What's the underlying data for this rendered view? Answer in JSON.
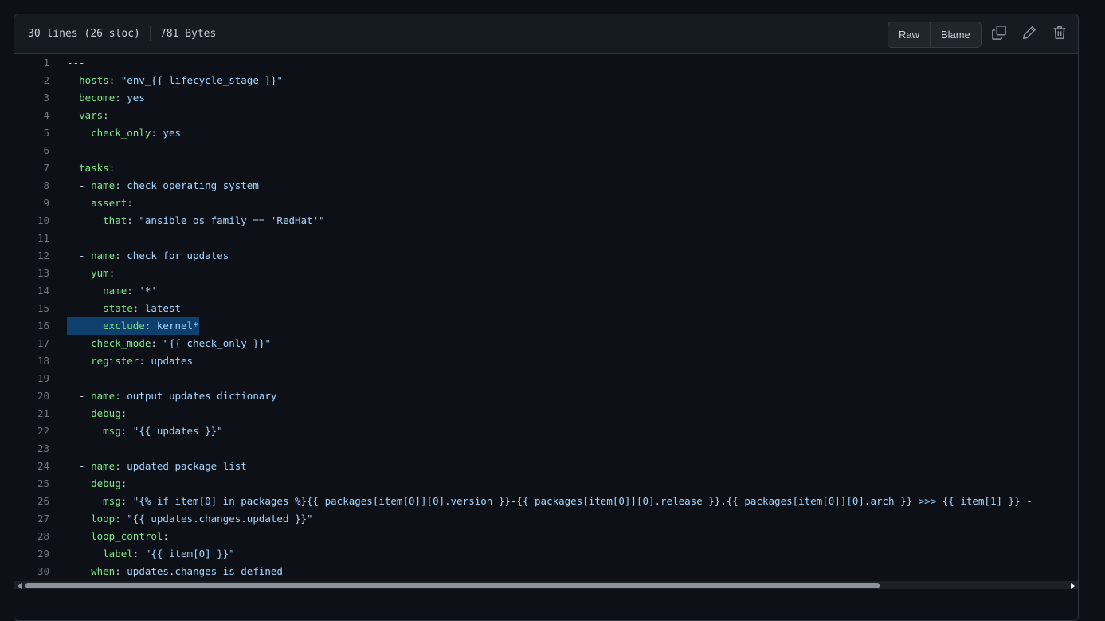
{
  "file_info": {
    "lines": "30 lines (26 sloc)",
    "size": "781 Bytes"
  },
  "toolbar": {
    "raw_label": "Raw",
    "blame_label": "Blame",
    "copy_icon": "copy-icon",
    "edit_icon": "pencil-icon",
    "delete_icon": "trash-icon"
  },
  "colors": {
    "background": "#0d1117",
    "header": "#161b22",
    "key": "#7ee787",
    "string": "#a5d6ff",
    "line_number": "#6e7681",
    "highlight": "#0f3f6c"
  },
  "code": {
    "highlighted_line": 16,
    "lines": [
      {
        "n": "1",
        "segs": [
          [
            "p",
            "---"
          ]
        ]
      },
      {
        "n": "2",
        "segs": [
          [
            "p",
            "- "
          ],
          [
            "k",
            "hosts"
          ],
          [
            "p",
            ": "
          ],
          [
            "s",
            "\"env_{{ lifecycle_stage }}\""
          ]
        ]
      },
      {
        "n": "3",
        "segs": [
          [
            "p",
            "  "
          ],
          [
            "k",
            "become"
          ],
          [
            "p",
            ": "
          ],
          [
            "s",
            "yes"
          ]
        ]
      },
      {
        "n": "4",
        "segs": [
          [
            "p",
            "  "
          ],
          [
            "k",
            "vars"
          ],
          [
            "p",
            ":"
          ]
        ]
      },
      {
        "n": "5",
        "segs": [
          [
            "p",
            "    "
          ],
          [
            "k",
            "check_only"
          ],
          [
            "p",
            ": "
          ],
          [
            "s",
            "yes"
          ]
        ]
      },
      {
        "n": "6",
        "segs": []
      },
      {
        "n": "7",
        "segs": [
          [
            "p",
            "  "
          ],
          [
            "k",
            "tasks"
          ],
          [
            "p",
            ":"
          ]
        ]
      },
      {
        "n": "8",
        "segs": [
          [
            "p",
            "  - "
          ],
          [
            "k",
            "name"
          ],
          [
            "p",
            ": "
          ],
          [
            "s",
            "check operating system"
          ]
        ]
      },
      {
        "n": "9",
        "segs": [
          [
            "p",
            "    "
          ],
          [
            "k",
            "assert"
          ],
          [
            "p",
            ":"
          ]
        ]
      },
      {
        "n": "10",
        "segs": [
          [
            "p",
            "      "
          ],
          [
            "k",
            "that"
          ],
          [
            "p",
            ": "
          ],
          [
            "s",
            "\"ansible_os_family == 'RedHat'\""
          ]
        ]
      },
      {
        "n": "11",
        "segs": []
      },
      {
        "n": "12",
        "segs": [
          [
            "p",
            "  - "
          ],
          [
            "k",
            "name"
          ],
          [
            "p",
            ": "
          ],
          [
            "s",
            "check for updates"
          ]
        ]
      },
      {
        "n": "13",
        "segs": [
          [
            "p",
            "    "
          ],
          [
            "k",
            "yum"
          ],
          [
            "p",
            ":"
          ]
        ]
      },
      {
        "n": "14",
        "segs": [
          [
            "p",
            "      "
          ],
          [
            "k",
            "name"
          ],
          [
            "p",
            ": "
          ],
          [
            "s",
            "'*'"
          ]
        ]
      },
      {
        "n": "15",
        "segs": [
          [
            "p",
            "      "
          ],
          [
            "k",
            "state"
          ],
          [
            "p",
            ": "
          ],
          [
            "s",
            "latest"
          ]
        ]
      },
      {
        "n": "16",
        "segs": [
          [
            "p",
            "      "
          ],
          [
            "k",
            "exclude"
          ],
          [
            "p",
            ": "
          ],
          [
            "s",
            "kernel*"
          ]
        ]
      },
      {
        "n": "17",
        "segs": [
          [
            "p",
            "    "
          ],
          [
            "k",
            "check_mode"
          ],
          [
            "p",
            ": "
          ],
          [
            "s",
            "\"{{ check_only }}\""
          ]
        ]
      },
      {
        "n": "18",
        "segs": [
          [
            "p",
            "    "
          ],
          [
            "k",
            "register"
          ],
          [
            "p",
            ": "
          ],
          [
            "s",
            "updates"
          ]
        ]
      },
      {
        "n": "19",
        "segs": []
      },
      {
        "n": "20",
        "segs": [
          [
            "p",
            "  - "
          ],
          [
            "k",
            "name"
          ],
          [
            "p",
            ": "
          ],
          [
            "s",
            "output updates dictionary"
          ]
        ]
      },
      {
        "n": "21",
        "segs": [
          [
            "p",
            "    "
          ],
          [
            "k",
            "debug"
          ],
          [
            "p",
            ":"
          ]
        ]
      },
      {
        "n": "22",
        "segs": [
          [
            "p",
            "      "
          ],
          [
            "k",
            "msg"
          ],
          [
            "p",
            ": "
          ],
          [
            "s",
            "\"{{ updates }}\""
          ]
        ]
      },
      {
        "n": "23",
        "segs": []
      },
      {
        "n": "24",
        "segs": [
          [
            "p",
            "  - "
          ],
          [
            "k",
            "name"
          ],
          [
            "p",
            ": "
          ],
          [
            "s",
            "updated package list"
          ]
        ]
      },
      {
        "n": "25",
        "segs": [
          [
            "p",
            "    "
          ],
          [
            "k",
            "debug"
          ],
          [
            "p",
            ":"
          ]
        ]
      },
      {
        "n": "26",
        "segs": [
          [
            "p",
            "      "
          ],
          [
            "k",
            "msg"
          ],
          [
            "p",
            ": "
          ],
          [
            "s",
            "\"{% if item[0] in packages %}{{ packages[item[0]][0].version }}-{{ packages[item[0]][0].release }}.{{ packages[item[0]][0].arch }} >>> {{ item[1] }} -"
          ]
        ]
      },
      {
        "n": "27",
        "segs": [
          [
            "p",
            "    "
          ],
          [
            "k",
            "loop"
          ],
          [
            "p",
            ": "
          ],
          [
            "s",
            "\"{{ updates.changes.updated }}\""
          ]
        ]
      },
      {
        "n": "28",
        "segs": [
          [
            "p",
            "    "
          ],
          [
            "k",
            "loop_control"
          ],
          [
            "p",
            ":"
          ]
        ]
      },
      {
        "n": "29",
        "segs": [
          [
            "p",
            "      "
          ],
          [
            "k",
            "label"
          ],
          [
            "p",
            ": "
          ],
          [
            "s",
            "\"{{ item[0] }}\""
          ]
        ]
      },
      {
        "n": "30",
        "segs": [
          [
            "p",
            "    "
          ],
          [
            "k",
            "when"
          ],
          [
            "p",
            ": "
          ],
          [
            "s",
            "updates.changes is defined"
          ]
        ]
      }
    ]
  }
}
